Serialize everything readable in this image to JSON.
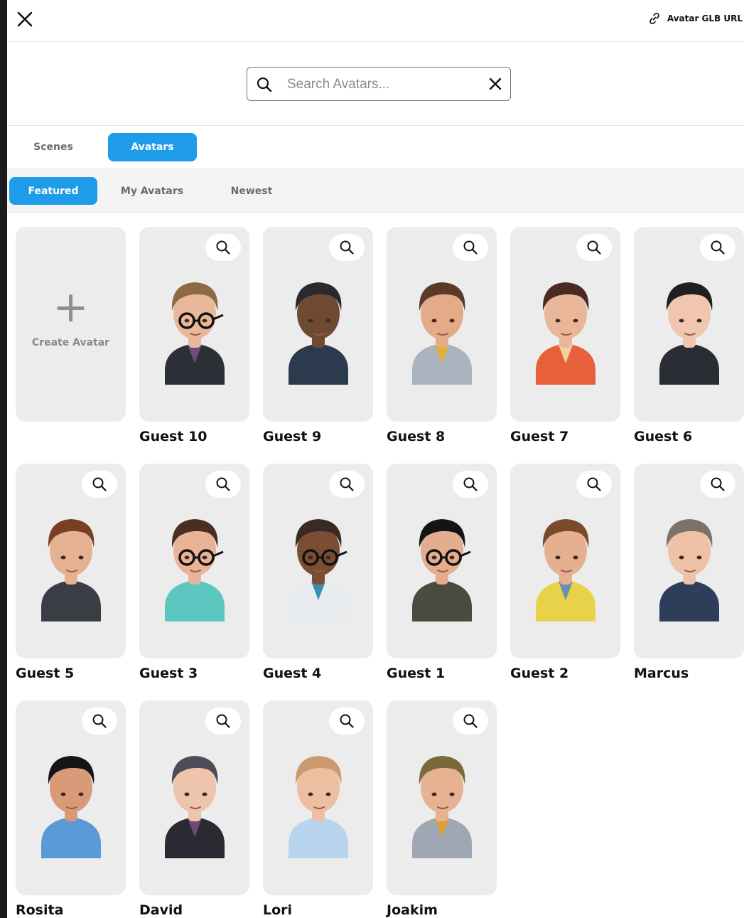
{
  "header": {
    "close_icon": "close-icon",
    "glb_link_label": "Avatar GLB URL",
    "glb_link_icon": "link-icon"
  },
  "search": {
    "placeholder": "Search Avatars...",
    "value": ""
  },
  "tabs": [
    {
      "label": "Scenes",
      "active": false
    },
    {
      "label": "Avatars",
      "active": true
    }
  ],
  "filters": [
    {
      "label": "Featured",
      "active": true
    },
    {
      "label": "My Avatars",
      "active": false
    },
    {
      "label": "Newest",
      "active": false
    }
  ],
  "create_card": {
    "label": "Create Avatar",
    "icon": "plus-icon"
  },
  "avatars": [
    {
      "name": "Guest 10",
      "skin": "#e9b89a",
      "hair": "#8b6a45",
      "shirt": "#2d2f36",
      "accent": "#6a4b7a",
      "glasses": true
    },
    {
      "name": "Guest 9",
      "skin": "#6e4a33",
      "hair": "#2a2a2e",
      "shirt": "#2c3a4e",
      "accent": "#2c3a4e",
      "glasses": false
    },
    {
      "name": "Guest 8",
      "skin": "#e4ab88",
      "hair": "#5a3b2a",
      "shirt": "#a9b4bf",
      "accent": "#e0b030",
      "glasses": false
    },
    {
      "name": "Guest 7",
      "skin": "#eab69a",
      "hair": "#4a2a22",
      "shirt": "#e8603a",
      "accent": "#f1d3a0",
      "glasses": false
    },
    {
      "name": "Guest 6",
      "skin": "#f0c7ae",
      "hair": "#1f1f22",
      "shirt": "#2a2d33",
      "accent": "#2a2d33",
      "glasses": false
    },
    {
      "name": "Guest 5",
      "skin": "#e6b092",
      "hair": "#7a3e22",
      "shirt": "#3a3d44",
      "accent": "#3a3d44",
      "glasses": false
    },
    {
      "name": "Guest 3",
      "skin": "#e8b396",
      "hair": "#4a2e22",
      "shirt": "#5cc7c0",
      "accent": "#5cc7c0",
      "glasses": true
    },
    {
      "name": "Guest 4",
      "skin": "#7a4e34",
      "hair": "#3a2a22",
      "shirt": "#e8ecef",
      "accent": "#3a8fb0",
      "glasses": true
    },
    {
      "name": "Guest 1",
      "skin": "#e3ad8e",
      "hair": "#141416",
      "shirt": "#4a4a3e",
      "accent": "#4a4a3e",
      "glasses": true
    },
    {
      "name": "Guest 2",
      "skin": "#e6b090",
      "hair": "#7a4a2a",
      "shirt": "#e8d24a",
      "accent": "#6a8fae",
      "glasses": false
    },
    {
      "name": "Marcus",
      "skin": "#eec2a6",
      "hair": "#7b7268",
      "shirt": "#2e3e5a",
      "accent": "#2e3e5a",
      "glasses": false
    },
    {
      "name": "Rosita",
      "skin": "#d99a78",
      "hair": "#151517",
      "shirt": "#5a9ad8",
      "accent": "#5a9ad8",
      "glasses": false
    },
    {
      "name": "David",
      "skin": "#eec4aa",
      "hair": "#4e4c5a",
      "shirt": "#2a2b32",
      "accent": "#6a4b7a",
      "glasses": false
    },
    {
      "name": "Lori",
      "skin": "#ecbfa2",
      "hair": "#cc9a6e",
      "shirt": "#b8d4ee",
      "accent": "#b8d4ee",
      "glasses": false
    },
    {
      "name": "Joakim",
      "skin": "#e6b292",
      "hair": "#7a6a3a",
      "shirt": "#9fa8b2",
      "accent": "#e0a030",
      "glasses": false
    }
  ]
}
